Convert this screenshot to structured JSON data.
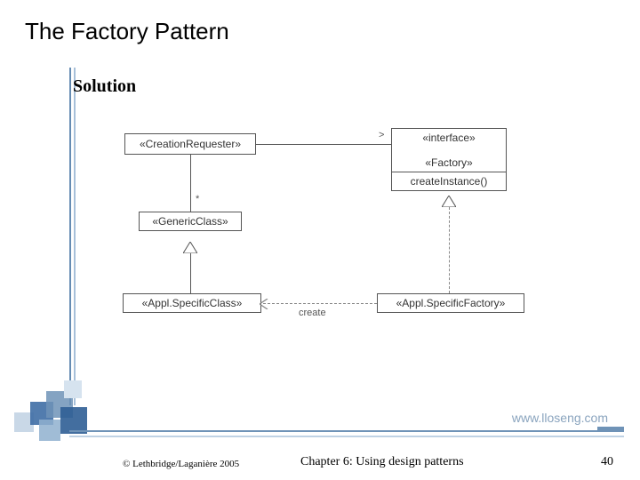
{
  "title": "The Factory Pattern",
  "subheading": "Solution",
  "diagram": {
    "creation_requester": "«CreationRequester»",
    "interface_stereo": "«interface»",
    "factory": "«Factory»",
    "create_instance": "createInstance()",
    "generic_class": "«GenericClass»",
    "appl_specific_class": "«Appl.SpecificClass»",
    "appl_specific_factory": "«Appl.SpecificFactory»",
    "assoc_arrow": ">",
    "multiplicity": "*",
    "create_label": "create"
  },
  "website": "www.lloseng.com",
  "copyright": "© Lethbridge/Laganière 2005",
  "chapter": "Chapter 6: Using design patterns",
  "page_number": "40",
  "chart_data": {
    "type": "diagram",
    "notation": "UML class diagram",
    "classes": [
      {
        "name": "CreationRequester",
        "stereotype": "«CreationRequester»"
      },
      {
        "name": "Factory",
        "stereotype": "«interface» «Factory»",
        "operations": [
          "createInstance()"
        ]
      },
      {
        "name": "GenericClass",
        "stereotype": "«GenericClass»"
      },
      {
        "name": "Appl.SpecificClass",
        "stereotype": "«Appl.SpecificClass»"
      },
      {
        "name": "Appl.SpecificFactory",
        "stereotype": "«Appl.SpecificFactory»"
      }
    ],
    "relationships": [
      {
        "from": "CreationRequester",
        "to": "Factory",
        "type": "association",
        "navigable_to": true
      },
      {
        "from": "CreationRequester",
        "to": "GenericClass",
        "type": "association",
        "multiplicity_to": "*"
      },
      {
        "from": "Appl.SpecificClass",
        "to": "GenericClass",
        "type": "generalization"
      },
      {
        "from": "Appl.SpecificFactory",
        "to": "Factory",
        "type": "realization"
      },
      {
        "from": "Appl.SpecificFactory",
        "to": "Appl.SpecificClass",
        "type": "dependency",
        "label": "create"
      }
    ]
  }
}
